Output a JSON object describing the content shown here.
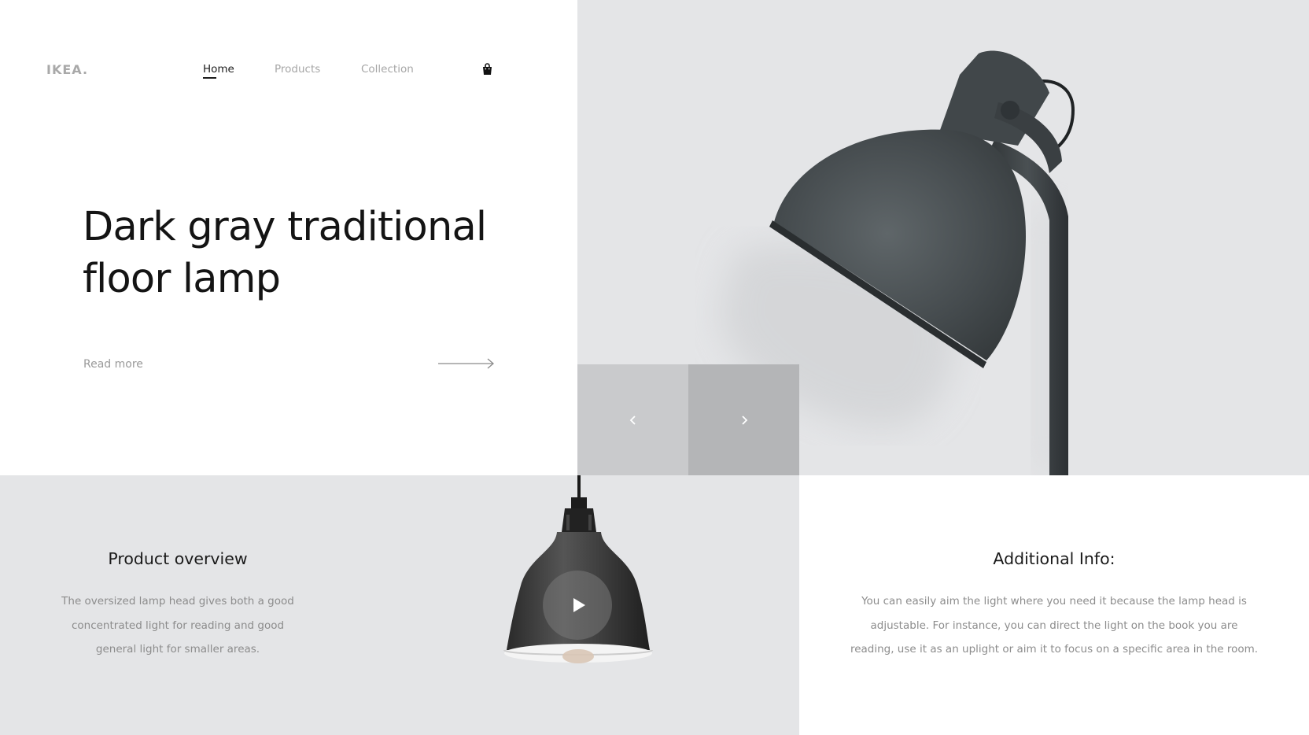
{
  "brand": {
    "logo": "IKEA."
  },
  "nav": {
    "items": [
      {
        "label": "Home",
        "active": true
      },
      {
        "label": "Products",
        "active": false
      },
      {
        "label": "Collection",
        "active": false
      }
    ],
    "cart_icon": "shopping-bag-icon"
  },
  "hero": {
    "title_line1": "Dark gray traditional",
    "title_line2": "floor lamp",
    "read_more": "Read more",
    "arrow_icon": "arrow-right-icon"
  },
  "slider": {
    "prev_icon": "chevron-left-icon",
    "next_icon": "chevron-right-icon"
  },
  "overview": {
    "title": "Product overview",
    "text_line1": "The oversized lamp head gives both a good",
    "text_line2": "concentrated light for reading and good",
    "text_line3": "general light for smaller areas.",
    "play_icon": "play-icon"
  },
  "additional": {
    "title": "Additional Info:",
    "text_line1": "You can easily aim the light where you need it because the lamp head is",
    "text_line2": "adjustable. For instance, you can direct the light on the book you are",
    "text_line3": "reading, use it as an uplight or aim it to focus on a specific area in the room."
  },
  "colors": {
    "panel_grey": "#e4e5e7",
    "slider_prev": "#c9cacc",
    "slider_next": "#b4b5b7",
    "lamp_color": "#3f4446",
    "text_dark": "#141414",
    "text_muted": "#8c8c8c"
  }
}
